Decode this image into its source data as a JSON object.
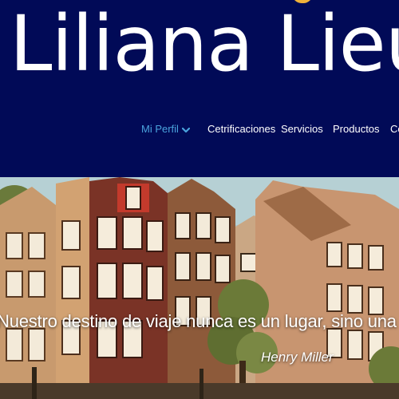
{
  "brand": {
    "logo_text": "Liliana Lieu"
  },
  "nav": {
    "items": [
      {
        "label": "Mi Perfil",
        "active": true
      },
      {
        "label": "Cetrificaciones",
        "active": false
      },
      {
        "label": "Servicios",
        "active": false
      },
      {
        "label": "Productos",
        "active": false
      },
      {
        "label": "Co",
        "active": false
      }
    ]
  },
  "hero": {
    "quote": "Nuestro destino de viaje nunca es un lugar, sino una nu",
    "author": "Henry Miller"
  },
  "colors": {
    "header_bg": "#010a57",
    "nav_text": "#ffffff",
    "nav_active": "#4aa3dd"
  }
}
